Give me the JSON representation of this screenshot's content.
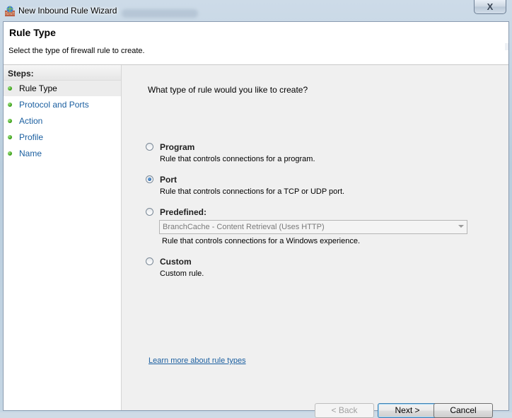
{
  "window": {
    "title": "New Inbound Rule Wizard",
    "close_glyph": "X"
  },
  "header": {
    "title": "Rule Type",
    "subtitle": "Select the type of firewall rule to create."
  },
  "steps": {
    "title": "Steps:",
    "items": [
      {
        "label": "Rule Type",
        "active": true
      },
      {
        "label": "Protocol and Ports",
        "active": false
      },
      {
        "label": "Action",
        "active": false
      },
      {
        "label": "Profile",
        "active": false
      },
      {
        "label": "Name",
        "active": false
      }
    ]
  },
  "main": {
    "question": "What type of rule would you like to create?",
    "options": [
      {
        "title": "Program",
        "description": "Rule that controls connections for a program.",
        "selected": false
      },
      {
        "title": "Port",
        "description": "Rule that controls connections for a TCP or UDP port.",
        "selected": true
      },
      {
        "title": "Predefined:",
        "description": "Rule that controls connections for a Windows experience.",
        "selected": false
      },
      {
        "title": "Custom",
        "description": "Custom rule.",
        "selected": false
      }
    ],
    "predefined_select": "BranchCache - Content Retrieval (Uses HTTP)",
    "learn_more": "Learn more about rule types"
  },
  "buttons": {
    "back": "< Back",
    "next": "Next >",
    "cancel": "Cancel"
  },
  "colors": {
    "link": "#1b5fa0",
    "step_dot": "#3fa51c",
    "panel_bg": "#f0f0f0"
  }
}
